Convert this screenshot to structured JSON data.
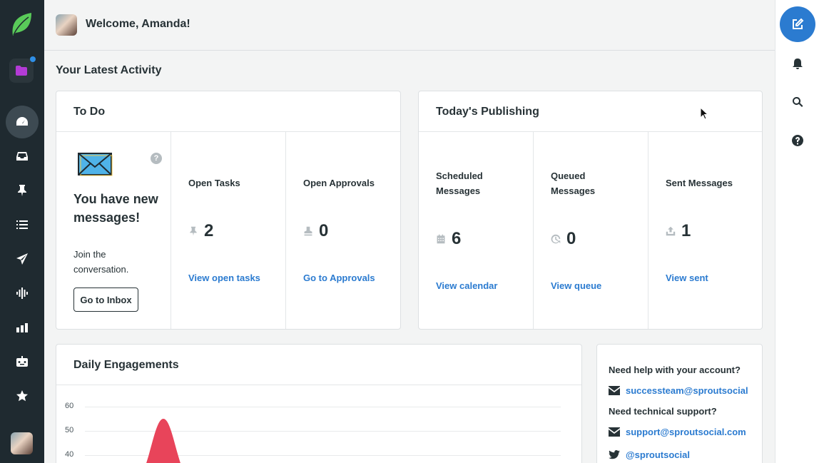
{
  "header": {
    "welcome": "Welcome, Amanda!"
  },
  "section_title": "Your Latest Activity",
  "nav": {
    "items": [
      "dashboard-icon",
      "inbox-icon",
      "pin-icon",
      "list-icon",
      "send-icon",
      "listening-icon",
      "reports-icon",
      "bot-icon",
      "star-icon"
    ],
    "folder_badge_color": "#2f8fe6",
    "folder_color": "#b33bd6"
  },
  "todo": {
    "title": "To Do",
    "help": "?",
    "headline": "You have new messages!",
    "sub": "Join the conversation.",
    "inbox_button": "Go to Inbox",
    "tasks_label": "Open Tasks",
    "tasks_value": "2",
    "tasks_link": "View open tasks",
    "approvals_label": "Open Approvals",
    "approvals_value": "0",
    "approvals_link": "Go to Approvals"
  },
  "publishing": {
    "title": "Today's Publishing",
    "scheduled_label": "Scheduled Messages",
    "scheduled_value": "6",
    "scheduled_link": "View calendar",
    "queued_label": "Queued Messages",
    "queued_value": "0",
    "queued_link": "View queue",
    "sent_label": "Sent Messages",
    "sent_value": "1",
    "sent_link": "View sent"
  },
  "engagements": {
    "title": "Daily Engagements"
  },
  "chart_data": {
    "type": "area",
    "title": "Daily Engagements",
    "y_ticks": [
      "60",
      "50",
      "40"
    ],
    "ylim": [
      40,
      60
    ],
    "series": [
      {
        "values": [
          40,
          55,
          40
        ]
      }
    ],
    "color": "#e8445a"
  },
  "help": {
    "account_q": "Need help with your account?",
    "account_email": "successteam@sproutsocial",
    "tech_q": "Need technical support?",
    "tech_email": "support@sproutsocial.com",
    "twitter": "@sproutsocial"
  },
  "colors": {
    "accent": "#2b7bd0",
    "nav_bg": "#1f2a30",
    "brand_green": "#59cb59"
  }
}
